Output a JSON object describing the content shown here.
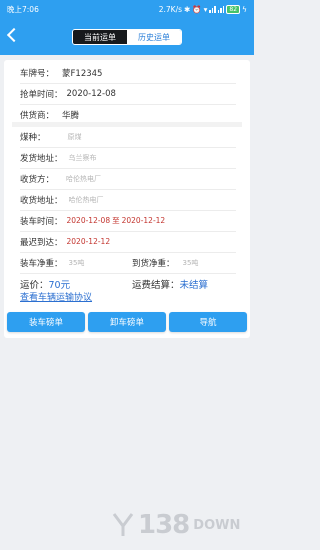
{
  "status_bar": {
    "time": "晚上7:06",
    "net_speed": "2.7K/s",
    "battery": "82",
    "colors": {
      "bar": "#2e9ff0"
    }
  },
  "header": {
    "back_icon": "chevron-left-icon",
    "tabs": [
      {
        "label": "当前运单",
        "active": true
      },
      {
        "label": "历史运单",
        "active": false
      }
    ]
  },
  "fields": {
    "plate": {
      "label": "车牌号：",
      "value": "蒙F12345"
    },
    "grab_time": {
      "label": "抢单时间：",
      "value": "2020-12-08"
    },
    "supplier": {
      "label": "供货商：",
      "value": "华腾"
    },
    "coal_type": {
      "label": "煤种：",
      "value": "原煤"
    },
    "ship_addr": {
      "label": "发货地址：",
      "value": "乌兰察布"
    },
    "receiver": {
      "label": "收货方：",
      "value": "哈伦热电厂"
    },
    "recv_addr": {
      "label": "收货地址：",
      "value": "哈伦热电厂"
    },
    "load_time": {
      "label": "装车时间：",
      "from": "2020-12-08",
      "to_word": "至",
      "to": "2020-12-12"
    },
    "latest_arrival": {
      "label": "最迟到达：",
      "value": "2020-12-12"
    },
    "load_weight": {
      "label": "装车净重：",
      "value": "35吨"
    },
    "arrive_weight": {
      "label": "到货净重：",
      "value": "35吨"
    },
    "freight_price": {
      "label": "运价：",
      "value": "70元"
    },
    "settlement": {
      "label": "运费结算：",
      "value": "未结算"
    }
  },
  "agreement_link": "查看车辆运输协议",
  "buttons": {
    "load_slip": "装车磅单",
    "unload_slip": "卸车磅单",
    "navigate": "导航"
  },
  "watermark": {
    "number": "138",
    "text": "DOWN"
  },
  "colors": {
    "accent": "#2e9ff0",
    "red_value": "#c3352f",
    "blue_value": "#2b6fd0"
  }
}
